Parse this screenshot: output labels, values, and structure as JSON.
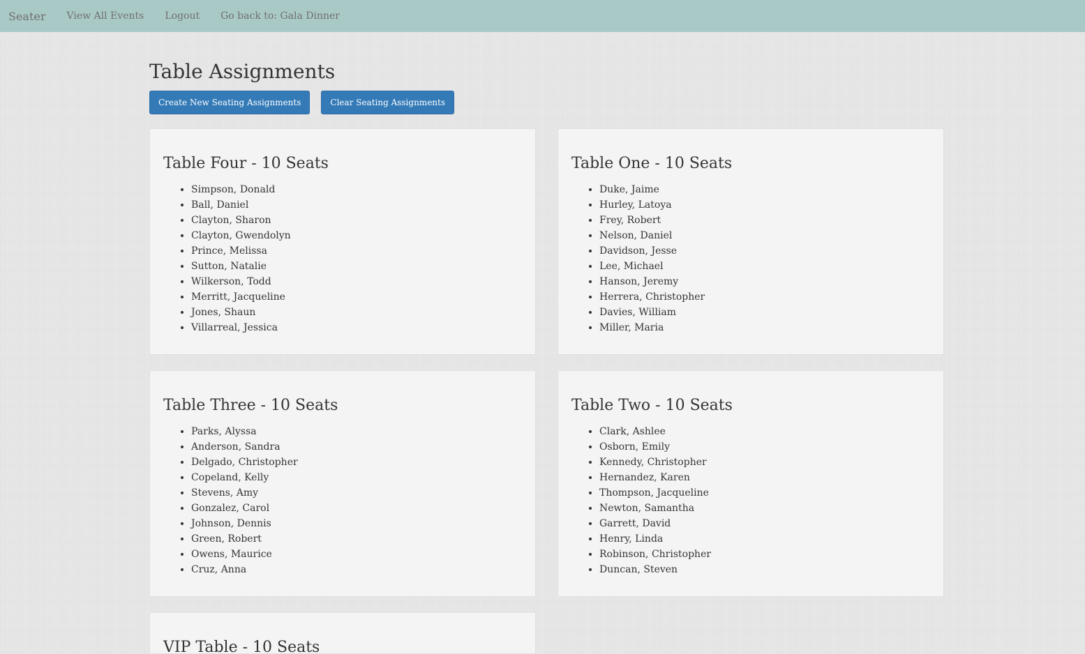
{
  "nav": {
    "brand": "Seater",
    "links": [
      "View All Events",
      "Logout",
      "Go back to: Gala Dinner"
    ]
  },
  "page": {
    "title": "Table Assignments",
    "create_button": "Create New Seating Assignments",
    "clear_button": "Clear Seating Assignments"
  },
  "tables": [
    {
      "title": "Table Four - 10 Seats",
      "guests": [
        "Simpson, Donald",
        "Ball, Daniel",
        "Clayton, Sharon",
        "Clayton, Gwendolyn",
        "Prince, Melissa",
        "Sutton, Natalie",
        "Wilkerson, Todd",
        "Merritt, Jacqueline",
        "Jones, Shaun",
        "Villarreal, Jessica"
      ]
    },
    {
      "title": "Table One - 10 Seats",
      "guests": [
        "Duke, Jaime",
        "Hurley, Latoya",
        "Frey, Robert",
        "Nelson, Daniel",
        "Davidson, Jesse",
        "Lee, Michael",
        "Hanson, Jeremy",
        "Herrera, Christopher",
        "Davies, William",
        "Miller, Maria"
      ]
    },
    {
      "title": "Table Three - 10 Seats",
      "guests": [
        "Parks, Alyssa",
        "Anderson, Sandra",
        "Delgado, Christopher",
        "Copeland, Kelly",
        "Stevens, Amy",
        "Gonzalez, Carol",
        "Johnson, Dennis",
        "Green, Robert",
        "Owens, Maurice",
        "Cruz, Anna"
      ]
    },
    {
      "title": "Table Two - 10 Seats",
      "guests": [
        "Clark, Ashlee",
        "Osborn, Emily",
        "Kennedy, Christopher",
        "Hernandez, Karen",
        "Thompson, Jacqueline",
        "Newton, Samantha",
        "Garrett, David",
        "Henry, Linda",
        "Robinson, Christopher",
        "Duncan, Steven"
      ]
    },
    {
      "title": "VIP Table - 10 Seats",
      "guests": []
    }
  ]
}
